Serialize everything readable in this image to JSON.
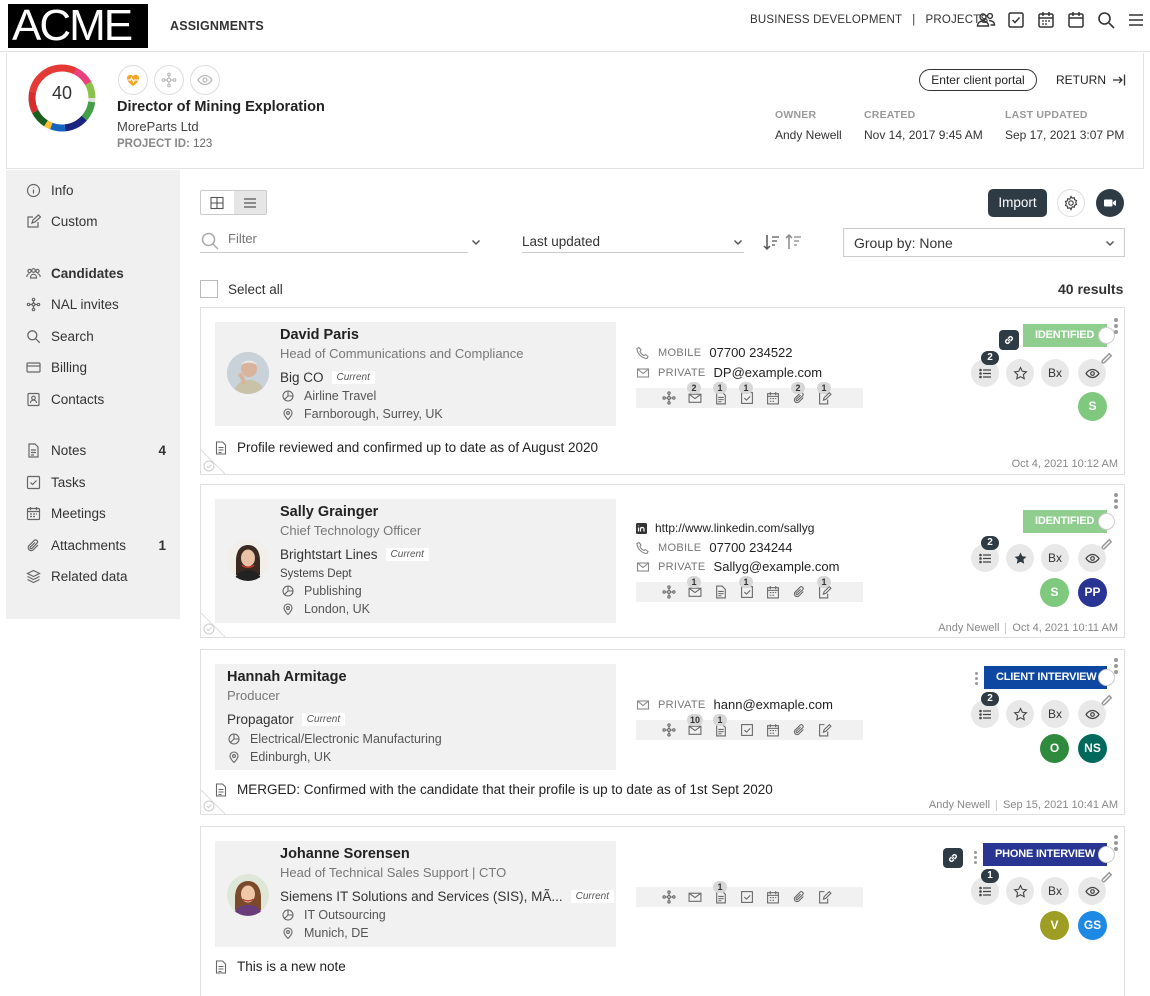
{
  "app": {
    "logo": "ACME",
    "section": "ASSIGNMENTS"
  },
  "topnav": {
    "links": [
      "BUSINESS DEVELOPMENT",
      "PROJECTS"
    ],
    "separator": "|"
  },
  "project": {
    "score": "40",
    "title": "Director of Mining Exploration",
    "company": "MoreParts Ltd",
    "id_label": "PROJECT ID:",
    "id_value": "123",
    "portal_button": "Enter client portal",
    "return_label": "RETURN",
    "meta": [
      {
        "label": "OWNER",
        "value": "Andy Newell"
      },
      {
        "label": "CREATED",
        "value": "Nov 14, 2017 9:45 AM"
      },
      {
        "label": "LAST UPDATED",
        "value": "Sep 17, 2021 3:07 PM"
      }
    ]
  },
  "sidebar": {
    "items": [
      {
        "label": "Info",
        "icon": "info-icon"
      },
      {
        "label": "Custom",
        "icon": "edit-icon"
      },
      {
        "label": "Candidates",
        "icon": "people-icon",
        "active": true
      },
      {
        "label": "NAL invites",
        "icon": "share-icon"
      },
      {
        "label": "Search",
        "icon": "search-icon"
      },
      {
        "label": "Billing",
        "icon": "card-icon"
      },
      {
        "label": "Contacts",
        "icon": "contact-icon"
      },
      {
        "label": "Notes",
        "icon": "document-icon",
        "count": "4"
      },
      {
        "label": "Tasks",
        "icon": "checkbox-icon"
      },
      {
        "label": "Meetings",
        "icon": "calendar-icon"
      },
      {
        "label": "Attachments",
        "icon": "paperclip-icon",
        "count": "1"
      },
      {
        "label": "Related data",
        "icon": "layers-icon"
      }
    ]
  },
  "toolbar": {
    "import_label": "Import",
    "filter_placeholder": "Filter",
    "sort_value": "Last updated",
    "group_by": "Group by: None",
    "select_all": "Select all",
    "results": "40 results"
  },
  "candidates": [
    {
      "name": "David Paris",
      "title": "Head of Communications and Compliance",
      "company": "Big CO",
      "current": "Current",
      "industry": "Airline Travel",
      "location": "Farnborough, Surrey, UK",
      "contacts": [
        {
          "type": "MOBILE",
          "value": "07700 234522"
        },
        {
          "type": "PRIVATE",
          "value": "DP@example.com"
        }
      ],
      "activity_badges": [
        "",
        "2",
        "1",
        "1",
        "",
        "2",
        "1"
      ],
      "status": "IDENTIFIED",
      "status_color": "#8fce8f",
      "list_badge": "2",
      "bx": "Bx",
      "users": [
        {
          "initials": "S",
          "color": "#7fc97f"
        }
      ],
      "note": "Profile reviewed and confirmed up to date as of August 2020",
      "footer_user": "",
      "footer_date": "Oct 4, 2021 10:12 AM"
    },
    {
      "name": "Sally Grainger",
      "title": "Chief Technology Officer",
      "company": "Brightstart Lines",
      "current": "Current",
      "dept": "Systems Dept",
      "industry": "Publishing",
      "location": "London, UK",
      "linkedin": "http://www.linkedin.com/sallyg",
      "contacts": [
        {
          "type": "MOBILE",
          "value": "07700 234244"
        },
        {
          "type": "PRIVATE",
          "value": "Sallyg@example.com"
        }
      ],
      "activity_badges": [
        "",
        "1",
        "",
        "1",
        "",
        "",
        "1"
      ],
      "status": "IDENTIFIED",
      "status_color": "#8fce8f",
      "list_badge": "2",
      "bx": "Bx",
      "users": [
        {
          "initials": "S",
          "color": "#7fc97f"
        },
        {
          "initials": "PP",
          "color": "#283593"
        }
      ],
      "note": "",
      "footer_user": "Andy Newell",
      "footer_date": "Oct 4, 2021 10:11 AM"
    },
    {
      "name": "Hannah Armitage",
      "title": "Producer",
      "company": "Propagator",
      "current": "Current",
      "industry": "Electrical/Electronic Manufacturing",
      "location": "Edinburgh, UK",
      "contacts": [
        {
          "type": "PRIVATE",
          "value": "hann@exmaple.com"
        }
      ],
      "activity_badges": [
        "",
        "10",
        "1",
        "",
        "",
        "",
        ""
      ],
      "status": "CLIENT INTERVIEW",
      "status_color": "#0d47a1",
      "list_badge": "2",
      "bx": "Bx",
      "users": [
        {
          "initials": "O",
          "color": "#2e8b3e"
        },
        {
          "initials": "NS",
          "color": "#00695c"
        }
      ],
      "note": "MERGED: Confirmed with the candidate that their profile is up to date as of 1st Sept 2020",
      "footer_user": "Andy Newell",
      "footer_date": "Sep 15, 2021 10:41 AM"
    },
    {
      "name": "Johanne Sorensen",
      "title": "Head of Technical Sales Support | CTO",
      "company": "Siemens IT Solutions and Services (SIS), MÃ...",
      "current": "Current",
      "industry": "IT Outsourcing",
      "location": "Munich, DE",
      "contacts": [],
      "activity_badges": [
        "",
        "",
        "1",
        "",
        "",
        "",
        ""
      ],
      "status": "PHONE INTERVIEW",
      "status_color": "#283593",
      "list_badge": "1",
      "bx": "Bx",
      "users": [
        {
          "initials": "V",
          "color": "#9e9d24"
        },
        {
          "initials": "GS",
          "color": "#1e88e5"
        }
      ],
      "note": "This is a new note",
      "footer_user": "",
      "footer_date": ""
    }
  ]
}
